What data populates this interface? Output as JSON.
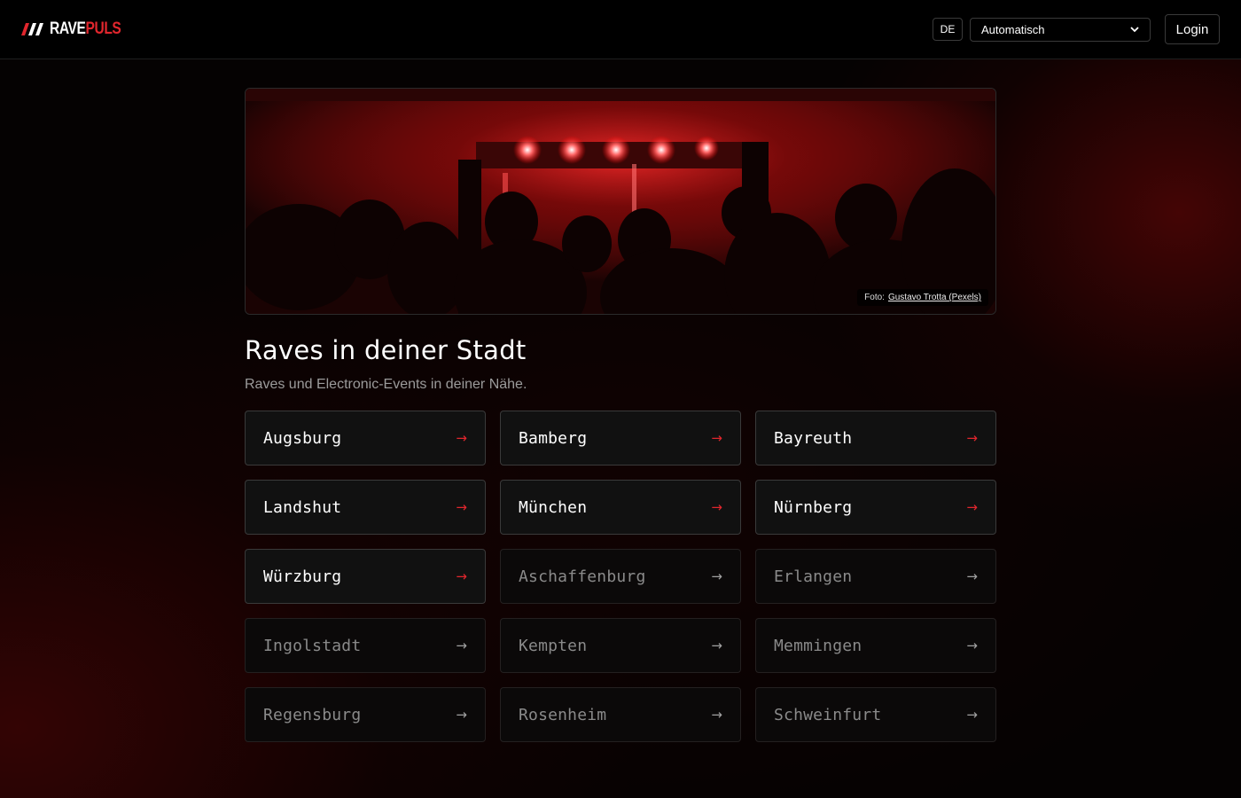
{
  "header": {
    "logo": {
      "part1": "RAVE",
      "part2": "PULS"
    },
    "language": "DE",
    "theme_select": {
      "value": "Automatisch"
    },
    "login_label": "Login"
  },
  "hero": {
    "credit_prefix": "Foto:",
    "credit_link": "Gustavo Trotta (Pexels)"
  },
  "main": {
    "title": "Raves in deiner Stadt",
    "subtitle": "Raves und Electronic-Events in deiner Nähe.",
    "cities": [
      {
        "name": "Augsburg",
        "arrow": "→",
        "active": true
      },
      {
        "name": "Bamberg",
        "arrow": "→",
        "active": true
      },
      {
        "name": "Bayreuth",
        "arrow": "→",
        "active": true
      },
      {
        "name": "Landshut",
        "arrow": "→",
        "active": true
      },
      {
        "name": "München",
        "arrow": "→",
        "active": true
      },
      {
        "name": "Nürnberg",
        "arrow": "→",
        "active": true
      },
      {
        "name": "Würzburg",
        "arrow": "→",
        "active": true
      },
      {
        "name": "Aschaffenburg",
        "arrow": "→",
        "active": false
      },
      {
        "name": "Erlangen",
        "arrow": "→",
        "active": false
      },
      {
        "name": "Ingolstadt",
        "arrow": "→",
        "active": false
      },
      {
        "name": "Kempten",
        "arrow": "→",
        "active": false
      },
      {
        "name": "Memmingen",
        "arrow": "→",
        "active": false
      },
      {
        "name": "Regensburg",
        "arrow": "→",
        "active": false
      },
      {
        "name": "Rosenheim",
        "arrow": "→",
        "active": false
      },
      {
        "name": "Schweinfurt",
        "arrow": "→",
        "active": false
      }
    ]
  },
  "colors": {
    "accent": "#e1262d",
    "background": "#050202"
  }
}
